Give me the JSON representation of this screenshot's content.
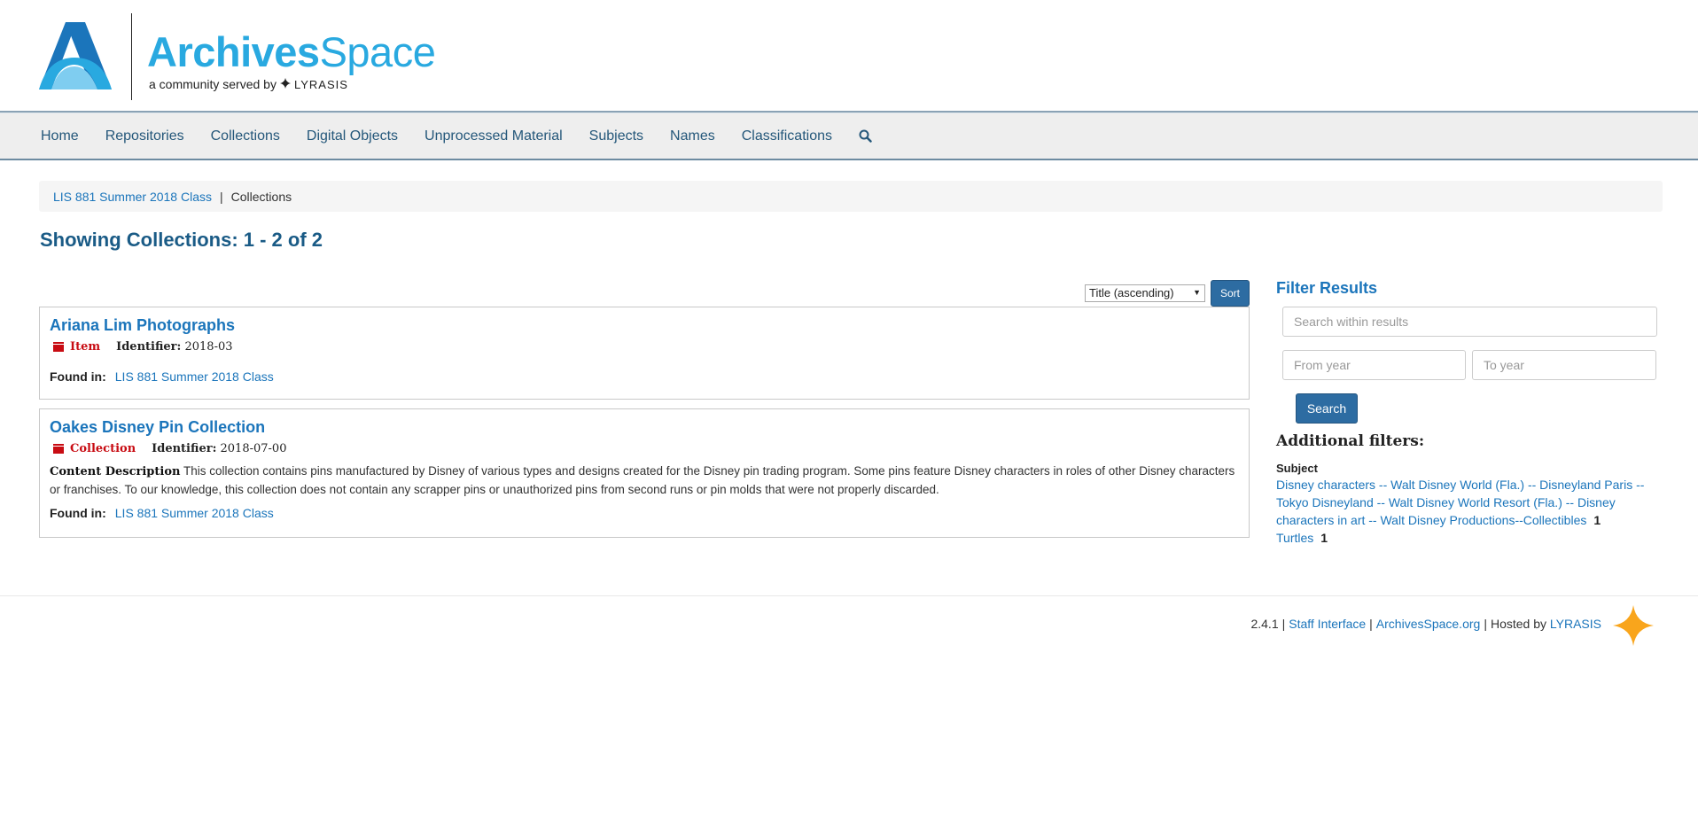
{
  "brand": {
    "word_bold": "Archives",
    "word_light": "Space",
    "tagline": "a community served by",
    "tagline_brand": "LYRASIS"
  },
  "nav": {
    "items": [
      "Home",
      "Repositories",
      "Collections",
      "Digital Objects",
      "Unprocessed Material",
      "Subjects",
      "Names",
      "Classifications"
    ],
    "search_icon": "search-icon"
  },
  "breadcrumb": {
    "repo": "LIS 881 Summer 2018 Class",
    "sep": "|",
    "current": "Collections"
  },
  "page_title": "Showing Collections: 1 - 2 of 2",
  "sort": {
    "selected": "Title (ascending)",
    "button": "Sort"
  },
  "results": [
    {
      "title": "Ariana Lim Photographs",
      "type": "Item",
      "identifier_label": "Identifier:",
      "identifier": "2018-03",
      "found_label": "Found in:",
      "found_in": "LIS 881 Summer 2018 Class"
    },
    {
      "title": "Oakes Disney Pin Collection",
      "type": "Collection",
      "identifier_label": "Identifier:",
      "identifier": "2018-07-00",
      "content_label": "Content Description",
      "content": "This collection contains pins manufactured by Disney of various types and designs created for the Disney pin trading program. Some pins feature Disney characters in roles of other Disney characters or franchises. To our knowledge, this collection does not contain any scrapper pins or unauthorized pins from second runs or pin molds that were not properly discarded.",
      "found_label": "Found in:",
      "found_in": "LIS 881 Summer 2018 Class"
    }
  ],
  "filter": {
    "heading": "Filter Results",
    "search_placeholder": "Search within results",
    "from_placeholder": "From year",
    "to_placeholder": "To year",
    "search_button": "Search",
    "additional": "Additional filters:",
    "subject_heading": "Subject",
    "facets": [
      {
        "label": "Disney characters -- Walt Disney World (Fla.) -- Disneyland Paris -- Tokyo Disneyland -- Walt Disney World Resort (Fla.) -- Disney characters in art -- Walt Disney Productions--Collectibles",
        "count": "1"
      },
      {
        "label": "Turtles",
        "count": "1"
      }
    ]
  },
  "footer": {
    "version": "2.4.1",
    "staff": "Staff Interface",
    "site": "ArchivesSpace.org",
    "hosted": "Hosted by",
    "host": "LYRASIS"
  },
  "colors": {
    "accent": "#1b75bb",
    "title": "#1a5b86",
    "badge": "#c80c13",
    "button": "#2d6ca2",
    "star": "#f9a51c"
  }
}
